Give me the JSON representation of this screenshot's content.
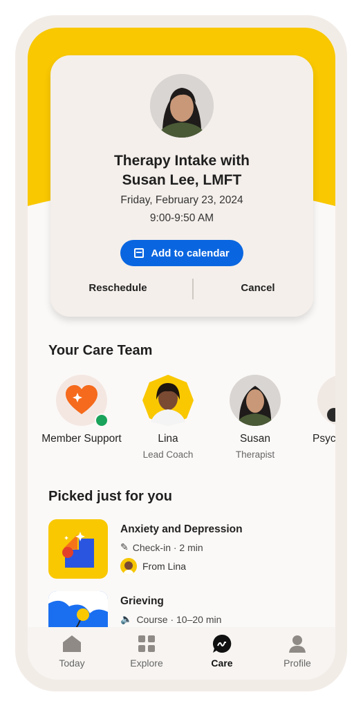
{
  "appointment": {
    "title": "Therapy Intake with\nSusan Lee, LMFT",
    "date": "Friday, February 23, 2024",
    "time": "9:00-9:50 AM",
    "add_calendar_label": "Add to calendar",
    "reschedule_label": "Reschedule",
    "cancel_label": "Cancel"
  },
  "care_team": {
    "title": "Your Care Team",
    "members": [
      {
        "name": "Member Support",
        "role": ""
      },
      {
        "name": "Lina",
        "role": "Lead Coach"
      },
      {
        "name": "Susan",
        "role": "Therapist"
      },
      {
        "name": "Psyc",
        "role": ""
      }
    ]
  },
  "picks": {
    "title": "Picked just for you",
    "items": [
      {
        "title": "Anxiety and Depression",
        "meta": "Check-in · 2 min",
        "from": "From Lina"
      },
      {
        "title": "Grieving",
        "meta": "Course · 10–20 min"
      }
    ]
  },
  "tabs": [
    {
      "label": "Today",
      "icon": "home-icon"
    },
    {
      "label": "Explore",
      "icon": "grid-icon"
    },
    {
      "label": "Care",
      "icon": "chat-icon",
      "active": true
    },
    {
      "label": "Profile",
      "icon": "person-icon"
    }
  ],
  "colors": {
    "accent": "#0a66e0",
    "brand_yellow": "#f9c800",
    "status_online": "#1aa35a"
  }
}
